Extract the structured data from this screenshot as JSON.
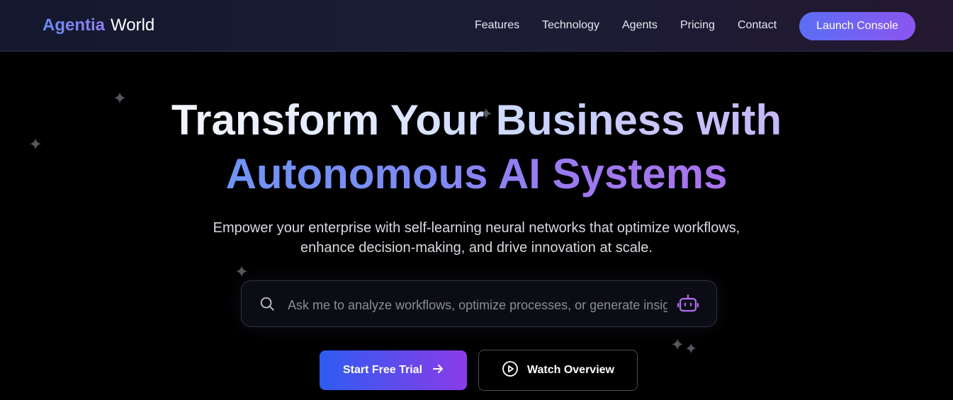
{
  "brand": {
    "part1": "Agentia",
    "part2": "World"
  },
  "nav": {
    "links": [
      "Features",
      "Technology",
      "Agents",
      "Pricing",
      "Contact"
    ],
    "cta": "Launch Console"
  },
  "hero": {
    "title_line1": "Transform Your Business with",
    "title_line2": "Autonomous AI Systems",
    "subtitle_line1": "Empower your enterprise with self-learning neural networks that optimize workflows,",
    "subtitle_line2": "enhance decision-making, and drive innovation at scale."
  },
  "search": {
    "placeholder": "Ask me to analyze workflows, optimize processes, or generate insights...",
    "value": "",
    "left_icon": "search-icon",
    "right_icon": "robot-icon"
  },
  "buttons": {
    "primary": "Start Free Trial",
    "primary_icon": "arrow-right-icon",
    "secondary": "Watch Overview",
    "secondary_icon": "play-circle-icon"
  },
  "colors": {
    "background": "#000000",
    "accent_blue": "#5b6ef5",
    "accent_purple": "#8b55ef",
    "bot_icon": "#b06ef3"
  }
}
